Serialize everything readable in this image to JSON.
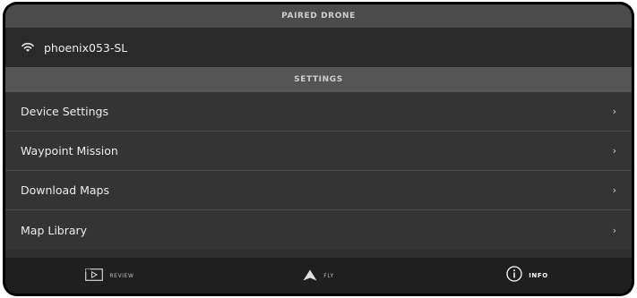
{
  "paired_drone": {
    "header": "PAIRED DRONE",
    "name": "phoenix053-SL",
    "icon": "wifi-icon"
  },
  "settings": {
    "header": "SETTINGS",
    "items": [
      {
        "label": "Device Settings",
        "icon": "chevron-right-icon"
      },
      {
        "label": "Waypoint Mission",
        "icon": "chevron-right-icon"
      },
      {
        "label": "Download Maps",
        "icon": "chevron-right-icon"
      },
      {
        "label": "Map Library",
        "icon": "chevron-right-icon"
      }
    ]
  },
  "bottom_nav": {
    "tabs": [
      {
        "label": "REVIEW",
        "icon": "play-box-icon",
        "active": false
      },
      {
        "label": "FLY",
        "icon": "arrow-up-icon",
        "active": false
      },
      {
        "label": "INFO",
        "icon": "info-circle-icon",
        "active": true
      }
    ]
  },
  "colors": {
    "header_bg": "#4b4b4b",
    "list_bg": "#343434",
    "bottom_bar_bg": "#1f1f1f",
    "text": "#ececec"
  }
}
